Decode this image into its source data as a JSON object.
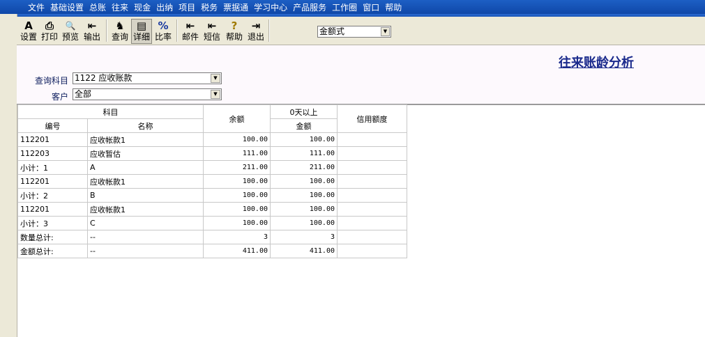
{
  "menu": [
    "文件",
    "基础设置",
    "总账",
    "往来",
    "现金",
    "出纳",
    "项目",
    "税务",
    "票据通",
    "学习中心",
    "产品服务",
    "工作圈",
    "窗口",
    "帮助"
  ],
  "toolbar": {
    "buttons": [
      {
        "label": "设置",
        "icon": "A"
      },
      {
        "label": "打印",
        "icon": "⎙"
      },
      {
        "label": "预览",
        "icon": "🔍"
      },
      {
        "label": "输出",
        "icon": "⇤"
      },
      {
        "label": "查询",
        "icon": "♞"
      },
      {
        "label": "详细",
        "icon": "▤"
      },
      {
        "label": "比率",
        "icon": "%"
      },
      {
        "label": "邮件",
        "icon": "⇤"
      },
      {
        "label": "短信",
        "icon": "⇤"
      },
      {
        "label": "帮助",
        "icon": "?"
      },
      {
        "label": "退出",
        "icon": "⇥"
      }
    ],
    "mode_value": "金额式"
  },
  "report": {
    "title": "往来账龄分析",
    "subject_label": "查询科目",
    "subject_value": "1122 应收账款",
    "customer_label": "客户",
    "customer_value": "全部"
  },
  "table": {
    "headers": {
      "subject": "科目",
      "code": "编号",
      "name": "名称",
      "balance": "余额",
      "aging": "0天以上",
      "amount": "金额",
      "credit": "信用额度"
    },
    "rows": [
      {
        "code": "112201",
        "name": "应收帐款1",
        "balance": "100.00",
        "amount": "100.00",
        "credit": ""
      },
      {
        "code": "112203",
        "name": "应收暂估",
        "balance": "111.00",
        "amount": "111.00",
        "credit": ""
      },
      {
        "code": "小计：1",
        "name": "A",
        "balance": "211.00",
        "amount": "211.00",
        "credit": ""
      },
      {
        "code": "112201",
        "name": "应收帐款1",
        "balance": "100.00",
        "amount": "100.00",
        "credit": ""
      },
      {
        "code": "小计：2",
        "name": "B",
        "balance": "100.00",
        "amount": "100.00",
        "credit": ""
      },
      {
        "code": "112201",
        "name": "应收帐款1",
        "balance": "100.00",
        "amount": "100.00",
        "credit": ""
      },
      {
        "code": "小计：3",
        "name": "C",
        "balance": "100.00",
        "amount": "100.00",
        "credit": ""
      },
      {
        "code": "数量总计:",
        "name": "--",
        "balance": "3",
        "amount": "3",
        "credit": ""
      },
      {
        "code": "金额总计:",
        "name": "--",
        "balance": "411.00",
        "amount": "411.00",
        "credit": ""
      }
    ]
  }
}
